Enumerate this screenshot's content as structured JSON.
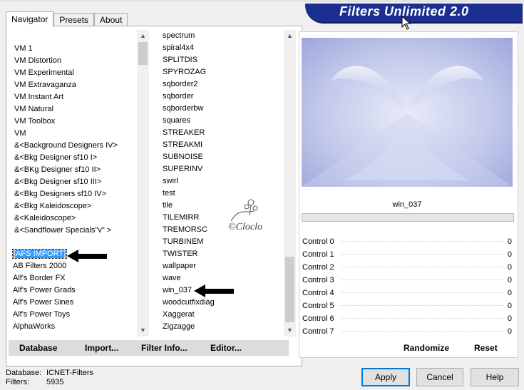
{
  "tabs": [
    "Navigator",
    "Presets",
    "About"
  ],
  "app_title": "Filters Unlimited 2.0",
  "categories": {
    "items": [
      "VM 1",
      "VM Distortion",
      "VM Experimental",
      "VM Extravaganza",
      "VM Instant Art",
      "VM Natural",
      "VM Toolbox",
      "VM",
      "&<Background Designers IV>",
      "&<Bkg Designer sf10 I>",
      "&<BKg Designer sf10 II>",
      "&<Bkg Designer sf10 III>",
      "&<Bkg Designers sf10 IV>",
      "&<Bkg Kaleidoscope>",
      "&<Kaleidoscope>",
      "&<Sandflower Specials\"v\" >"
    ],
    "items2": [
      "[AFS IMPORT]",
      "AB Filters 2000",
      "Alf's Border FX",
      "Alf's Power Grads",
      "Alf's Power Sines",
      "Alf's Power Toys",
      "AlphaWorks"
    ],
    "selected": "[AFS IMPORT]"
  },
  "filters": {
    "items": [
      "spectrum",
      "spiral4x4",
      "SPLITDIS",
      "SPYROZAG",
      "sqborder2",
      "sqborder",
      "sqborderbw",
      "squares",
      "STREAKER",
      "STREAKMI",
      "SUBNOISE",
      "SUPERINV",
      "swirl",
      "test",
      "tile",
      "TILEMIRR",
      "TREMORSC",
      "TURBINEM",
      "TWISTER",
      "wallpaper",
      "wave",
      "win_037",
      "woodcutfixdiag",
      "Xaggerat",
      "Zigzagge"
    ]
  },
  "bottom_buttons": {
    "database": "Database",
    "import": "Import...",
    "filter_info": "Filter Info...",
    "editor": "Editor..."
  },
  "preview": {
    "filter_name": "win_037"
  },
  "controls": [
    {
      "label": "Control 0",
      "value": "0"
    },
    {
      "label": "Control 1",
      "value": "0"
    },
    {
      "label": "Control 2",
      "value": "0"
    },
    {
      "label": "Control 3",
      "value": "0"
    },
    {
      "label": "Control 4",
      "value": "0"
    },
    {
      "label": "Control 5",
      "value": "0"
    },
    {
      "label": "Control 6",
      "value": "0"
    },
    {
      "label": "Control 7",
      "value": "0"
    }
  ],
  "right_buttons": {
    "randomize": "Randomize",
    "reset": "Reset"
  },
  "status": {
    "database_label": "Database:",
    "database_value": "ICNET-Filters",
    "filters_label": "Filters:",
    "filters_value": "5935"
  },
  "dialog_buttons": {
    "apply": "Apply",
    "cancel": "Cancel",
    "help": "Help"
  },
  "watermark_text": "©Cloclo",
  "colors": {
    "banner": "#1a2f8f",
    "selection": "#3399ff",
    "preview": "#b4bde4"
  }
}
